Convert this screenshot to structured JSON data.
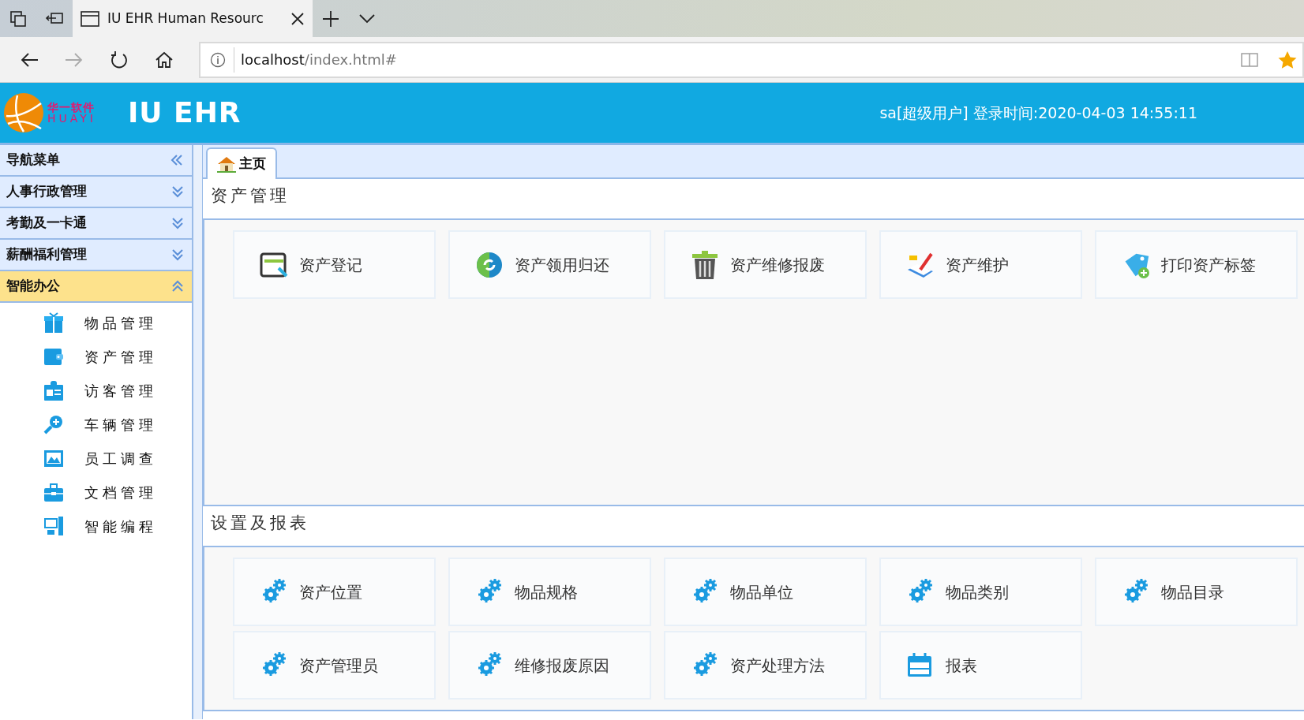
{
  "browser": {
    "tabs": [
      {
        "title": "IU EHR Human Resourc",
        "selected": true
      }
    ],
    "url": {
      "host": "localhost",
      "path": "/index.html#"
    }
  },
  "header": {
    "logo": {
      "cn": "华一软件",
      "en": "HUAYI"
    },
    "app_title": "IU EHR",
    "user_info": "sa[超级用户] 登录时间:2020-04-03 14:55:11"
  },
  "sidebar": {
    "title": "导航菜单",
    "groups": [
      {
        "label": "人事行政管理",
        "expanded": false
      },
      {
        "label": "考勤及一卡通",
        "expanded": false
      },
      {
        "label": "薪酬福利管理",
        "expanded": false
      },
      {
        "label": "智能办公",
        "expanded": true,
        "children": [
          {
            "label": "物品管理"
          },
          {
            "label": "资产管理"
          },
          {
            "label": "访客管理"
          },
          {
            "label": "车辆管理"
          },
          {
            "label": "员工调查"
          },
          {
            "label": "文档管理"
          },
          {
            "label": "智能编程"
          }
        ]
      }
    ]
  },
  "content_tabs": [
    {
      "label": "主页",
      "selected": true
    }
  ],
  "sections": [
    {
      "title": "资产管理",
      "items": [
        {
          "label": "资产登记"
        },
        {
          "label": "资产领用归还"
        },
        {
          "label": "资产维修报废"
        },
        {
          "label": "资产维护"
        },
        {
          "label": "打印资产标签"
        }
      ]
    },
    {
      "title": "设置及报表",
      "items": [
        {
          "label": "资产位置"
        },
        {
          "label": "物品规格"
        },
        {
          "label": "物品单位"
        },
        {
          "label": "物品类别"
        },
        {
          "label": "物品目录"
        },
        {
          "label": "资产管理员"
        },
        {
          "label": "维修报废原因"
        },
        {
          "label": "资产处理方法"
        },
        {
          "label": "报表"
        }
      ]
    }
  ]
}
